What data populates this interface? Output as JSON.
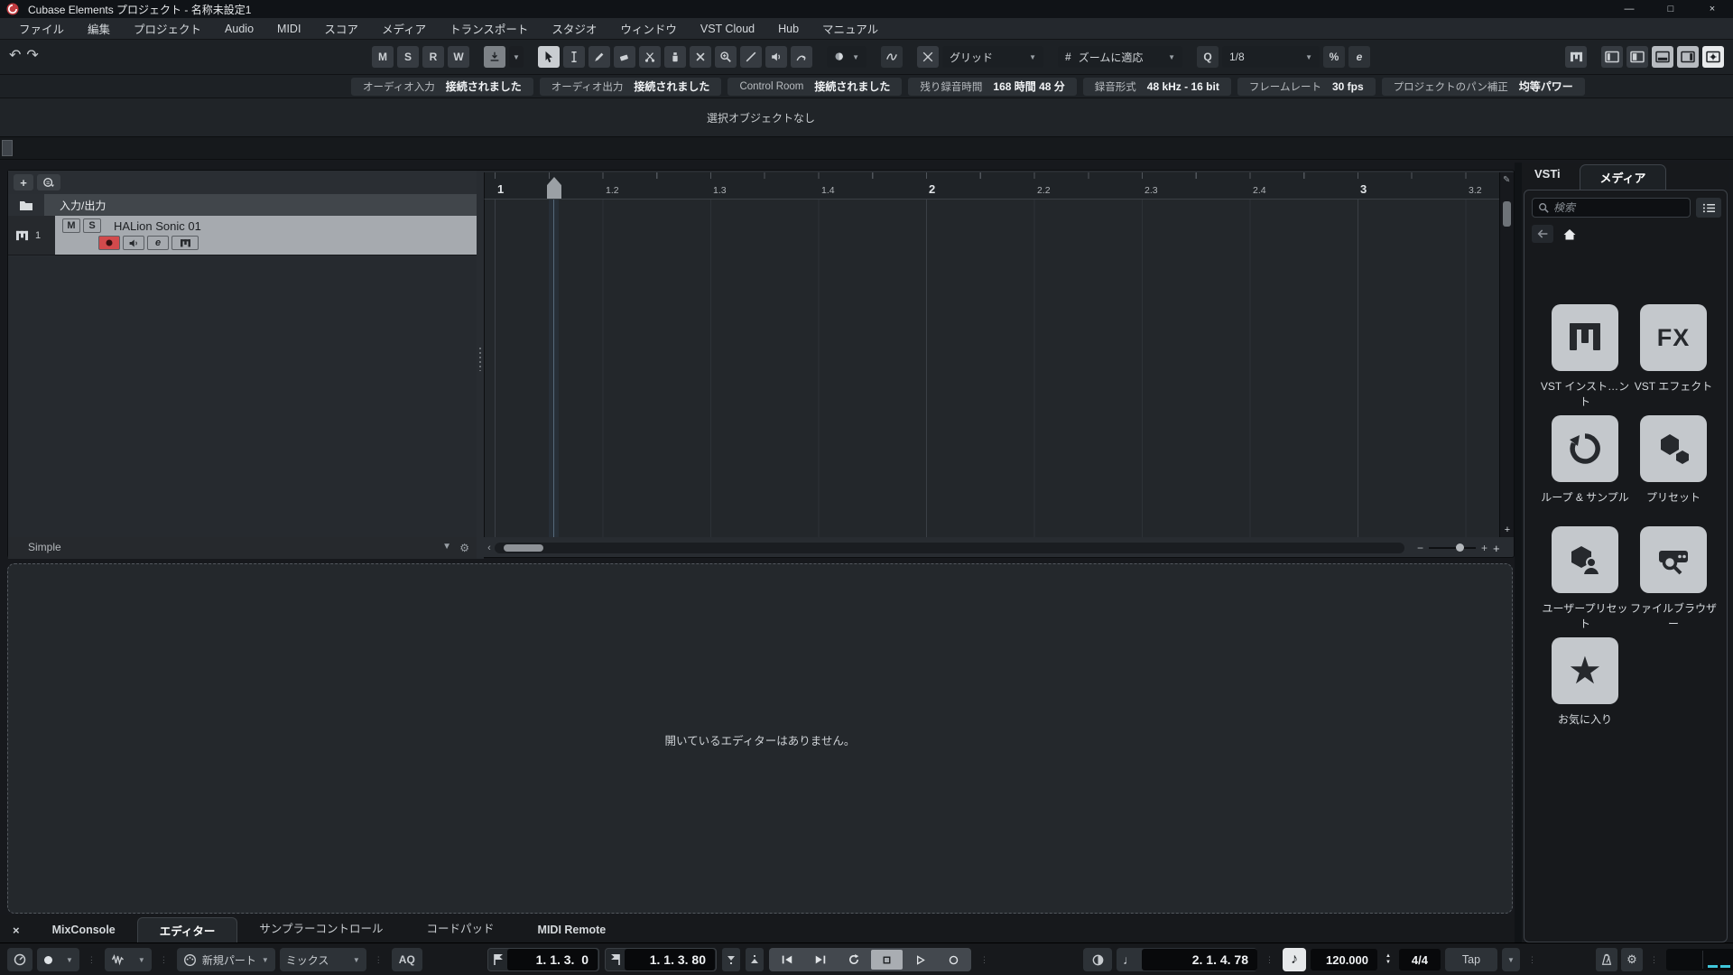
{
  "window": {
    "title": "Cubase Elements プロジェクト - 名称未設定1",
    "minimize": "—",
    "maximize": "□",
    "close": "×"
  },
  "menu": {
    "items": [
      "ファイル",
      "編集",
      "プロジェクト",
      "Audio",
      "MIDI",
      "スコア",
      "メディア",
      "トランスポート",
      "スタジオ",
      "ウィンドウ",
      "VST Cloud",
      "Hub",
      "マニュアル"
    ]
  },
  "icons": {
    "undo": "↶",
    "redo": "↷",
    "caret_down": "▼",
    "caret_up": "▲",
    "dots": "⋮",
    "close": "×",
    "plus": "+",
    "minus": "−",
    "star": "★",
    "gear": "⚙",
    "note_quarter": "♩",
    "note_eighth": "♪",
    "left_arrow": "‹",
    "pencil": "✎"
  },
  "toolbar": {
    "msrw": [
      "M",
      "S",
      "R",
      "W"
    ],
    "snap_dropdown": "グリッド",
    "zoom_hash": "#",
    "zoom_dropdown": "ズームに適応",
    "quantize_q": "Q",
    "quantize_value": "1/8",
    "iterative_quantize": "%",
    "quantize_panel": "e"
  },
  "infoline": {
    "items": [
      {
        "label": "オーディオ入力",
        "value": "接続されました"
      },
      {
        "label": "オーディオ出力",
        "value": "接続されました"
      },
      {
        "label": "Control Room",
        "value": "接続されました"
      },
      {
        "label": "残り録音時間",
        "value": "168 時間 48 分"
      },
      {
        "label": "録音形式",
        "value": "48 kHz - 16 bit"
      },
      {
        "label": "フレームレート",
        "value": "30 fps"
      },
      {
        "label": "プロジェクトのパン補正",
        "value": "均等パワー"
      }
    ]
  },
  "status": {
    "selection": "選択オブジェクトなし"
  },
  "tracklist": {
    "io_label": "入力/出力",
    "preset_label": "Simple",
    "track": {
      "number": "1",
      "mute": "M",
      "solo": "S",
      "name": "HALion Sonic 01",
      "edit": "e"
    }
  },
  "ruler": {
    "ticks": [
      "1",
      "1.2",
      "1.3",
      "1.4",
      "2",
      "2.2",
      "2.3",
      "2.4",
      "3",
      "3.2"
    ]
  },
  "media_rack": {
    "tabs": {
      "vsti": "VSTi",
      "media": "メディア"
    },
    "search_placeholder": "検索",
    "tiles": [
      {
        "label": "VST インスト…ント"
      },
      {
        "label": "VST エフェクト",
        "icon_text": "FX"
      },
      {
        "label": "ループ & サンプル"
      },
      {
        "label": "プリセット"
      },
      {
        "label": "ユーザープリセット"
      },
      {
        "label": "ファイルブラウザー"
      },
      {
        "label": "お気に入り"
      }
    ]
  },
  "lower_zone": {
    "empty_text": "開いているエディターはありません。",
    "tabs": [
      "MixConsole",
      "エディター",
      "サンプラーコントロール",
      "コードパッド",
      "MIDI Remote"
    ]
  },
  "transport": {
    "midi_record_mode": "新規パート",
    "audio_record_mode": "ミックス",
    "aq": "AQ",
    "left_locator": "1. 1. 3.  0",
    "right_locator": "1. 1. 3. 80",
    "position": "2. 1. 4. 78",
    "tempo": "120.000",
    "time_signature": "4/4",
    "tap": "Tap"
  },
  "colors": {
    "record_red": "#d24a4c",
    "meter_cyan": "#3fc6da",
    "selected_track": "#a6aaaf"
  }
}
